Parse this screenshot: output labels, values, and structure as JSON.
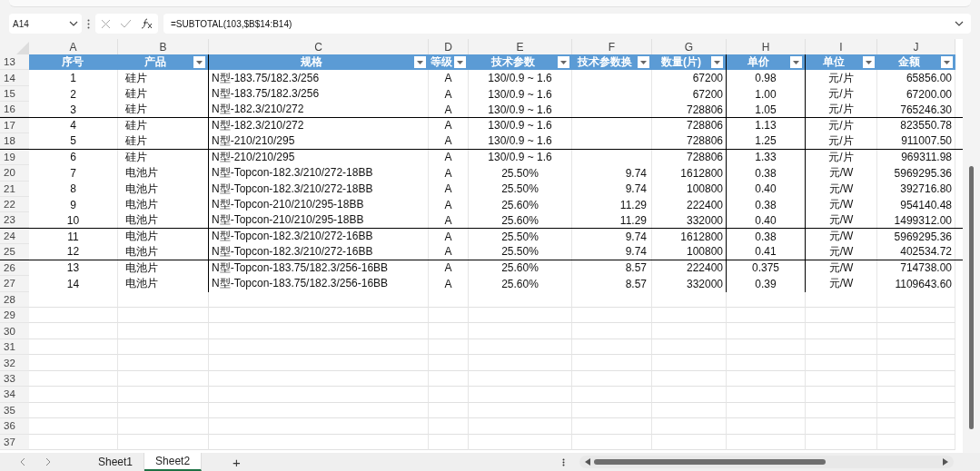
{
  "formula_bar": {
    "name_box": "A14",
    "formula": "=SUBTOTAL(103,$B$14:B14)"
  },
  "column_letters": [
    "A",
    "B",
    "C",
    "D",
    "E",
    "F",
    "G",
    "H",
    "I",
    "J"
  ],
  "header_row": {
    "row_number": "13",
    "cells": [
      {
        "label": "序号",
        "filter": false
      },
      {
        "label": "产品",
        "filter": true
      },
      {
        "label": "规格",
        "filter": true
      },
      {
        "label": "等级",
        "filter": true
      },
      {
        "label": "技术参数",
        "filter": true
      },
      {
        "label": "技术参数换",
        "filter": true
      },
      {
        "label": "数量(片)",
        "filter": true
      },
      {
        "label": "单价",
        "filter": true
      },
      {
        "label": "单位",
        "filter": true
      },
      {
        "label": "金额",
        "filter": true
      }
    ]
  },
  "rows": [
    {
      "row_number": "14",
      "border_below": false,
      "cells": [
        "1",
        "硅片",
        "N型-183.75/182.3/256",
        "A",
        "130/0.9 ~ 1.6",
        "",
        "67200",
        "0.98",
        "元/片",
        "65856.00"
      ]
    },
    {
      "row_number": "15",
      "border_below": false,
      "cells": [
        "2",
        "硅片",
        "N型-183.75/182.3/256",
        "A",
        "130/0.9 ~ 1.6",
        "",
        "67200",
        "1.00",
        "元/片",
        "67200.00"
      ]
    },
    {
      "row_number": "16",
      "border_below": true,
      "cells": [
        "3",
        "硅片",
        "N型-182.3/210/272",
        "A",
        "130/0.9 ~ 1.6",
        "",
        "728806",
        "1.05",
        "元/片",
        "765246.30"
      ]
    },
    {
      "row_number": "17",
      "border_below": false,
      "cells": [
        "4",
        "硅片",
        "N型-182.3/210/272",
        "A",
        "130/0.9 ~ 1.6",
        "",
        "728806",
        "1.13",
        "元/片",
        "823550.78"
      ]
    },
    {
      "row_number": "18",
      "border_below": true,
      "cells": [
        "5",
        "硅片",
        "N型-210/210/295",
        "A",
        "130/0.9 ~ 1.6",
        "",
        "728806",
        "1.25",
        "元/片",
        "911007.50"
      ]
    },
    {
      "row_number": "19",
      "border_below": false,
      "cells": [
        "6",
        "硅片",
        "N型-210/210/295",
        "A",
        "130/0.9 ~ 1.6",
        "",
        "728806",
        "1.33",
        "元/片",
        "969311.98"
      ]
    },
    {
      "row_number": "20",
      "border_below": false,
      "cells": [
        "7",
        "电池片",
        "N型-Topcon-182.3/210/272-18BB",
        "A",
        "25.50%",
        "9.74",
        "1612800",
        "0.38",
        "元/W",
        "5969295.36"
      ]
    },
    {
      "row_number": "21",
      "border_below": false,
      "cells": [
        "8",
        "电池片",
        "N型-Topcon-182.3/210/272-18BB",
        "A",
        "25.50%",
        "9.74",
        "100800",
        "0.40",
        "元/W",
        "392716.80"
      ]
    },
    {
      "row_number": "22",
      "border_below": false,
      "cells": [
        "9",
        "电池片",
        "N型-Topcon-210/210/295-18BB",
        "A",
        "25.60%",
        "11.29",
        "222400",
        "0.38",
        "元/W",
        "954140.48"
      ]
    },
    {
      "row_number": "23",
      "border_below": true,
      "cells": [
        "10",
        "电池片",
        "N型-Topcon-210/210/295-18BB",
        "A",
        "25.60%",
        "11.29",
        "332000",
        "0.40",
        "元/W",
        "1499312.00"
      ]
    },
    {
      "row_number": "24",
      "border_below": false,
      "cells": [
        "11",
        "电池片",
        "N型-Topcon-182.3/210/272-16BB",
        "A",
        "25.50%",
        "9.74",
        "1612800",
        "0.38",
        "元/W",
        "5969295.36"
      ]
    },
    {
      "row_number": "25",
      "border_below": true,
      "cells": [
        "12",
        "电池片",
        "N型-Topcon-182.3/210/272-16BB",
        "A",
        "25.50%",
        "9.74",
        "100800",
        "0.41",
        "元/W",
        "402534.72"
      ]
    },
    {
      "row_number": "26",
      "border_below": false,
      "cells": [
        "13",
        "电池片",
        "N型-Topcon-183.75/182.3/256-16BB",
        "A",
        "25.60%",
        "8.57",
        "222400",
        "0.375",
        "元/W",
        "714738.00"
      ]
    },
    {
      "row_number": "27",
      "border_below": false,
      "cells": [
        "14",
        "电池片",
        "N型-Topcon-183.75/182.3/256-16BB",
        "A",
        "25.60%",
        "8.57",
        "332000",
        "0.39",
        "元/W",
        "1109643.60"
      ]
    }
  ],
  "empty_rows": [
    "28",
    "29",
    "30",
    "31",
    "32",
    "33",
    "34",
    "35",
    "36",
    "37"
  ],
  "sheet_tabs": [
    {
      "label": "Sheet1",
      "selected": false
    },
    {
      "label": "Sheet2",
      "selected": true
    }
  ],
  "add_sheet": "+"
}
